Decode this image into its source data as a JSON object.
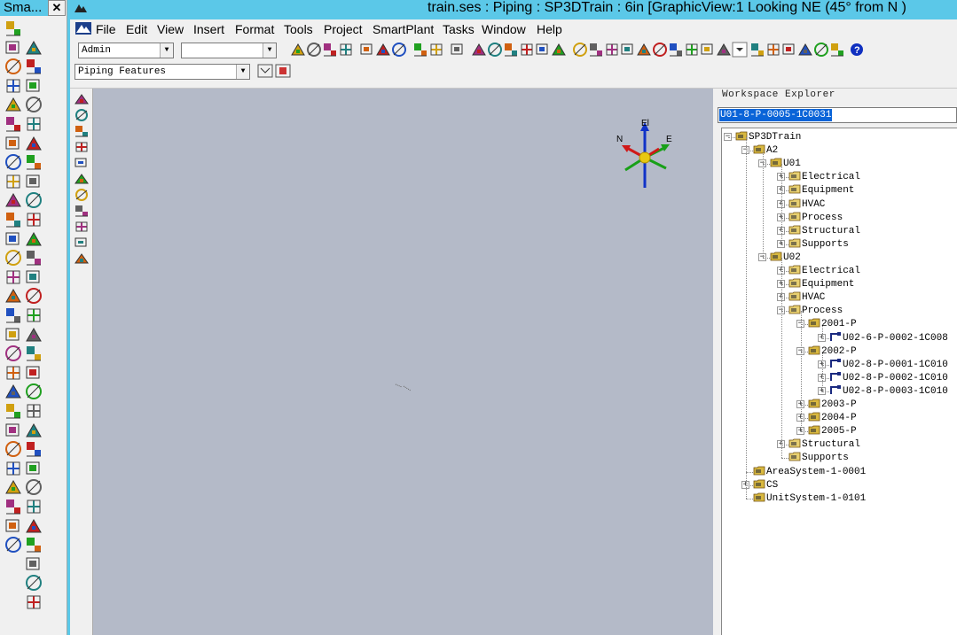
{
  "palette": {
    "title": "Sma...",
    "close_label": "✕"
  },
  "window": {
    "title": "train.ses : Piping : SP3DTrain : 6in    [GraphicView:1    Looking NE (45° from N )"
  },
  "menu": {
    "items": [
      "File",
      "Edit",
      "View",
      "Insert",
      "Format",
      "Tools",
      "Project",
      "SmartPlant",
      "Tasks",
      "Window",
      "Help"
    ]
  },
  "toolbar": {
    "permission_group": "Admin",
    "second_combo": "",
    "locate_filter": "Piping Features"
  },
  "workspace_explorer": {
    "title": "Workspace Explorer",
    "search_value": "U01-8-P-0005-1C0031",
    "tree": [
      {
        "label": "SP3DTrain",
        "level": 0,
        "expander": "-"
      },
      {
        "label": "A2",
        "level": 1,
        "expander": "-"
      },
      {
        "label": "U01",
        "level": 2,
        "expander": "-"
      },
      {
        "label": "Electrical",
        "level": 3,
        "expander": "+"
      },
      {
        "label": "Equipment",
        "level": 3,
        "expander": "+"
      },
      {
        "label": "HVAC",
        "level": 3,
        "expander": "+"
      },
      {
        "label": "Process",
        "level": 3,
        "expander": "+"
      },
      {
        "label": "Structural",
        "level": 3,
        "expander": "+"
      },
      {
        "label": "Supports",
        "level": 3,
        "expander": "+"
      },
      {
        "label": "U02",
        "level": 2,
        "expander": "-"
      },
      {
        "label": "Electrical",
        "level": 3,
        "expander": "+"
      },
      {
        "label": "Equipment",
        "level": 3,
        "expander": "+"
      },
      {
        "label": "HVAC",
        "level": 3,
        "expander": "+"
      },
      {
        "label": "Process",
        "level": 3,
        "expander": "-"
      },
      {
        "label": "2001-P",
        "level": 4,
        "expander": "-"
      },
      {
        "label": "U02-6-P-0002-1C008",
        "level": 5,
        "expander": "+"
      },
      {
        "label": "2002-P",
        "level": 4,
        "expander": "-"
      },
      {
        "label": "U02-8-P-0001-1C010",
        "level": 5,
        "expander": "+"
      },
      {
        "label": "U02-8-P-0002-1C010",
        "level": 5,
        "expander": "+"
      },
      {
        "label": "U02-8-P-0003-1C010",
        "level": 5,
        "expander": "+"
      },
      {
        "label": "2003-P",
        "level": 4,
        "expander": "+"
      },
      {
        "label": "2004-P",
        "level": 4,
        "expander": "+"
      },
      {
        "label": "2005-P",
        "level": 4,
        "expander": "+"
      },
      {
        "label": "Structural",
        "level": 3,
        "expander": "+"
      },
      {
        "label": "Supports",
        "level": 3,
        "expander": ""
      },
      {
        "label": "AreaSystem-1-0001",
        "level": 1,
        "expander": ""
      },
      {
        "label": "CS",
        "level": 1,
        "expander": "+"
      },
      {
        "label": "UnitSystem-1-0101",
        "level": 1,
        "expander": ""
      }
    ]
  },
  "graphic_view": {
    "compass_labels": {
      "up": "El",
      "north": "N",
      "east": "E"
    }
  },
  "colors": {
    "title_bar": "#5bc8e8",
    "graphic_bg": "#b4bac8",
    "selection": "#0a64d8"
  }
}
